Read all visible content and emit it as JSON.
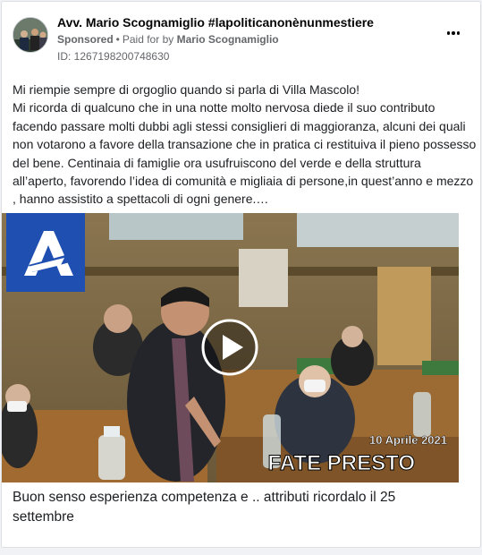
{
  "post": {
    "page_name": "Avv. Mario Scognamiglio #lapoliticanonènunmestiere",
    "sponsored_label": "Sponsored",
    "separator": "•",
    "paid_for_label": "Paid for by",
    "paid_for_name": "Mario Scognamiglio",
    "ad_id": "ID: 1267198200748630",
    "more_icon": "more-horizontal-icon",
    "body": "Mi riempie sempre di orgoglio quando si parla di Villa Mascolo!\nMi ricorda di qualcuno che in una notte molto nervosa diede il suo contributo facendo passare molti dubbi agli stessi consiglieri di maggioranza, alcuni dei quali non votarono a favore della transazione che in pratica ci restituiva il pieno possesso del bene. Centinaia di famiglie ora usufruiscono del verde e della struttura all’aperto, favorendo l’idea di comunità e migliaia di persone,in quest’anno e mezzo , hanno assistito a spettacoli di ogni genere.…",
    "video": {
      "date_overlay": "10 Aprile 2021",
      "title_overlay": "FATE PRESTO",
      "logo_icon": "channel-logo-icon",
      "play_icon": "play-icon"
    },
    "caption": "Buon senso esperienza competenza e .. attributi ricordalo il 25 settembre"
  },
  "colors": {
    "logo_blue": "#1f4fb0",
    "text_secondary": "#65676b",
    "overlay_text": "#ffffff"
  }
}
